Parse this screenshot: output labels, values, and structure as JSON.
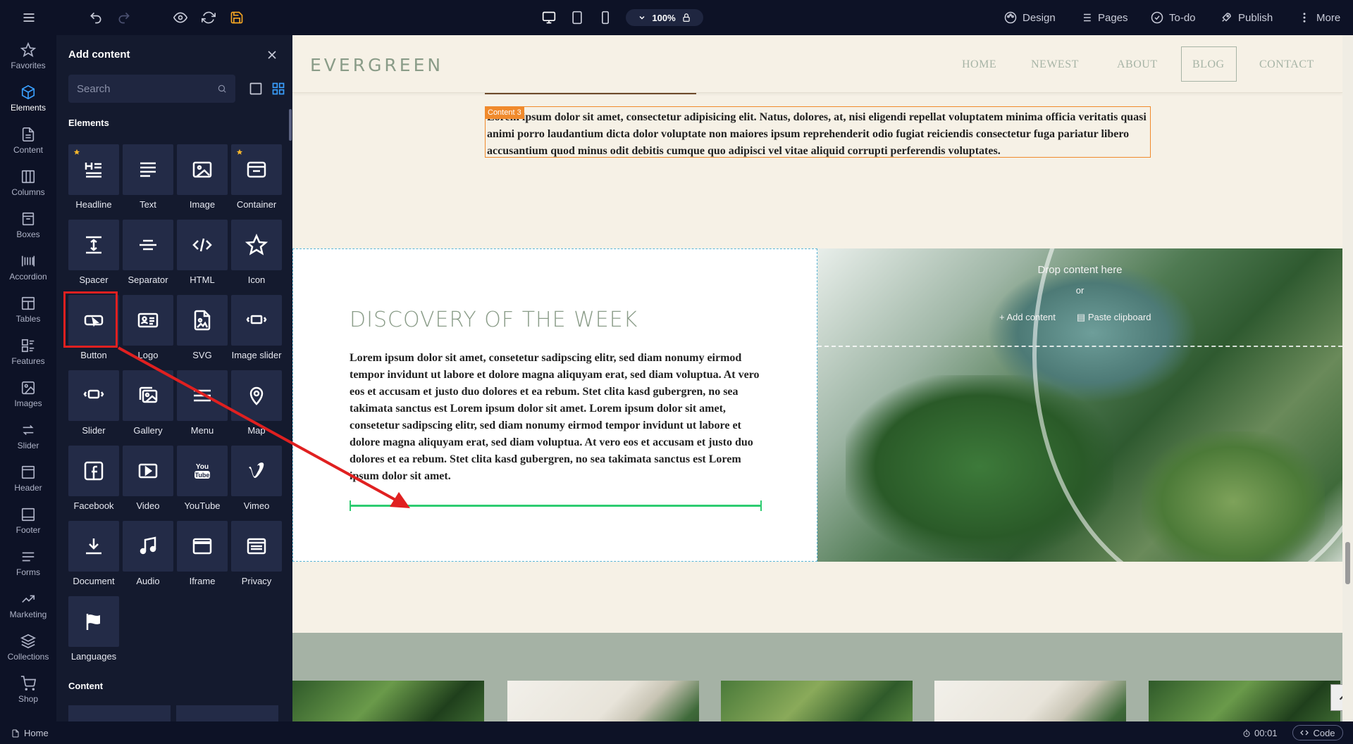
{
  "toolbar": {
    "zoom_level": "100%",
    "design_label": "Design",
    "pages_label": "Pages",
    "todo_label": "To-do",
    "publish_label": "Publish",
    "more_label": "More"
  },
  "leftnav": {
    "items": [
      {
        "label": "Favorites",
        "icon": "star-icon"
      },
      {
        "label": "Elements",
        "icon": "cube-icon"
      },
      {
        "label": "Content",
        "icon": "document-icon"
      },
      {
        "label": "Columns",
        "icon": "columns-icon"
      },
      {
        "label": "Boxes",
        "icon": "box-icon"
      },
      {
        "label": "Accordion",
        "icon": "accordion-icon"
      },
      {
        "label": "Tables",
        "icon": "table-icon"
      },
      {
        "label": "Features",
        "icon": "features-icon"
      },
      {
        "label": "Images",
        "icon": "image-icon"
      },
      {
        "label": "Slider",
        "icon": "slider-icon"
      },
      {
        "label": "Header",
        "icon": "header-icon"
      },
      {
        "label": "Footer",
        "icon": "footer-icon"
      },
      {
        "label": "Forms",
        "icon": "forms-icon"
      },
      {
        "label": "Marketing",
        "icon": "marketing-icon"
      },
      {
        "label": "Collections",
        "icon": "collections-icon"
      },
      {
        "label": "Shop",
        "icon": "cart-icon"
      }
    ]
  },
  "panel": {
    "title": "Add content",
    "search_placeholder": "Search",
    "section_elements": "Elements",
    "section_content": "Content",
    "tiles": [
      {
        "label": "Headline",
        "icon": "headline-icon",
        "starred": true
      },
      {
        "label": "Text",
        "icon": "text-icon",
        "starred": false
      },
      {
        "label": "Image",
        "icon": "image-icon",
        "starred": false
      },
      {
        "label": "Container",
        "icon": "container-icon",
        "starred": true
      },
      {
        "label": "Spacer",
        "icon": "spacer-icon",
        "starred": false
      },
      {
        "label": "Separator",
        "icon": "separator-icon",
        "starred": false
      },
      {
        "label": "HTML",
        "icon": "code-icon",
        "starred": false
      },
      {
        "label": "Icon",
        "icon": "star-outline-icon",
        "starred": false
      },
      {
        "label": "Button",
        "icon": "button-icon",
        "starred": false
      },
      {
        "label": "Logo",
        "icon": "logo-icon",
        "starred": false
      },
      {
        "label": "SVG",
        "icon": "svg-icon",
        "starred": false
      },
      {
        "label": "Image slider",
        "icon": "image-slider-icon",
        "starred": false
      },
      {
        "label": "Slider",
        "icon": "slider-icon",
        "starred": false
      },
      {
        "label": "Gallery",
        "icon": "gallery-icon",
        "starred": false
      },
      {
        "label": "Menu",
        "icon": "menu-icon",
        "starred": false
      },
      {
        "label": "Map",
        "icon": "map-pin-icon",
        "starred": false
      },
      {
        "label": "Facebook",
        "icon": "facebook-icon",
        "starred": false
      },
      {
        "label": "Video",
        "icon": "video-icon",
        "starred": false
      },
      {
        "label": "YouTube",
        "icon": "youtube-icon",
        "starred": false
      },
      {
        "label": "Vimeo",
        "icon": "vimeo-icon",
        "starred": false
      },
      {
        "label": "Document",
        "icon": "download-icon",
        "starred": false
      },
      {
        "label": "Audio",
        "icon": "music-icon",
        "starred": false
      },
      {
        "label": "Iframe",
        "icon": "iframe-icon",
        "starred": false
      },
      {
        "label": "Privacy",
        "icon": "privacy-icon",
        "starred": false
      },
      {
        "label": "Languages",
        "icon": "flag-icon",
        "starred": false
      }
    ]
  },
  "site": {
    "logo": "EVERGREEN",
    "nav": [
      "HOME",
      "NEWEST",
      "ABOUT",
      "BLOG",
      "CONTACT"
    ],
    "active_nav": "BLOG",
    "content_badge": "Content 3",
    "content_text": "Lorem ipsum dolor sit amet, consectetur adipisicing elit. Natus, dolores, at, nisi eligendi repellat voluptatem minima officia veritatis quasi animi porro laudantium dicta dolor voluptate non maiores ipsum reprehenderit odio fugiat reiciendis consectetur fuga pariatur libero accusantium quod minus odit debitis cumque quo adipisci vel vitae aliquid corrupti perferendis voluptates.",
    "discovery_title": "DISCOVERY OF THE WEEK",
    "discovery_text": "Lorem ipsum dolor sit amet, consetetur sadipscing elitr, sed diam nonumy eirmod tempor invidunt ut labore et dolore magna aliquyam erat, sed diam voluptua. At vero eos et accusam et justo duo dolores et ea rebum. Stet clita kasd gubergren, no sea takimata sanctus est Lorem ipsum dolor sit amet. Lorem ipsum dolor sit amet, consetetur sadipscing elitr, sed diam nonumy eirmod tempor invidunt ut labore et dolore magna aliquyam erat, sed diam voluptua. At vero eos et accusam et justo duo dolores et ea rebum. Stet clita kasd gubergren, no sea takimata sanctus est Lorem ipsum dolor sit amet.",
    "drop_here": "Drop content here",
    "drop_or": "or",
    "add_content": "Add content",
    "paste_clipboard": "Paste clipboard"
  },
  "bottombar": {
    "page": "Home",
    "time": "00:01",
    "code_label": "Code"
  }
}
